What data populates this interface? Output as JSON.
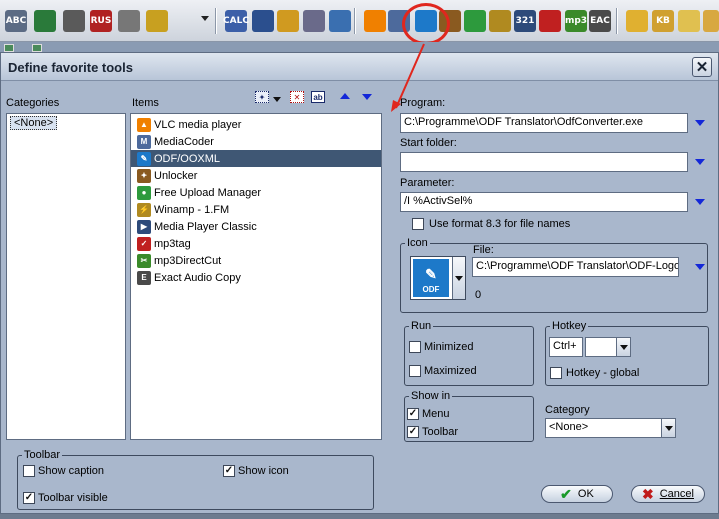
{
  "colors": {
    "accent": "#3f5774",
    "highlight": "#e0271e",
    "arrow_blue": "#1327d8",
    "dialog_bg": "#a9b7cc"
  },
  "toolbar": {
    "icons": [
      {
        "name": "abc-icon",
        "text": "ABC",
        "color": "#5b6b84"
      },
      {
        "name": "globe-icon",
        "text": "",
        "color": "#2a7a3a"
      },
      {
        "name": "document-icon",
        "text": "",
        "color": "#5a5a5a"
      },
      {
        "name": "rus-icon",
        "text": "RUS",
        "color": "#b02222"
      },
      {
        "name": "page-icon",
        "text": "",
        "color": "#777"
      },
      {
        "name": "new-doc-icon",
        "text": "",
        "color": "#c8a020"
      },
      {
        "name": "calc-icon",
        "text": "CALC",
        "color": "#3c5fa8"
      },
      {
        "name": "calendar-icon",
        "text": "",
        "color": "#2b4f8e"
      },
      {
        "name": "tools-icon",
        "text": "",
        "color": "#d09a20"
      },
      {
        "name": "sync-icon",
        "text": "",
        "color": "#6a6a8a"
      },
      {
        "name": "grid-icon",
        "text": "",
        "color": "#3a6fb0"
      },
      {
        "name": "vlc-icon",
        "text": "",
        "color": "#f08000"
      },
      {
        "name": "media-coder-icon",
        "text": "",
        "color": "#4d6a9c"
      },
      {
        "name": "odf-icon",
        "text": "",
        "color": "#1d79c9"
      },
      {
        "name": "unlocker-icon",
        "text": "",
        "color": "#8a5a20"
      },
      {
        "name": "upload-icon",
        "text": "",
        "color": "#2d9a3d"
      },
      {
        "name": "winamp-icon",
        "text": "",
        "color": "#b08a20"
      },
      {
        "name": "mpc-icon",
        "text": "321",
        "color": "#2d4a7a"
      },
      {
        "name": "mp3tag-icon",
        "text": "",
        "color": "#c02020"
      },
      {
        "name": "mp3cut-icon",
        "text": "mp3",
        "color": "#3a8a2a"
      },
      {
        "name": "eac-icon",
        "text": "EAC",
        "color": "#4a4a4a"
      },
      {
        "name": "folder-icon",
        "text": "",
        "color": "#e0b030"
      },
      {
        "name": "kb-icon",
        "text": "KB",
        "color": "#d0a030"
      },
      {
        "name": "note-icon",
        "text": "",
        "color": "#e0c050"
      },
      {
        "name": "folder2-icon",
        "text": "",
        "color": "#d8a840"
      }
    ]
  },
  "dialog": {
    "title": "Define favorite tools",
    "close_label": "✕",
    "categories_label": "Categories",
    "categories": [
      "<None>"
    ],
    "items_label": "Items",
    "items": [
      {
        "label": "VLC media player",
        "icon": "vlc-icon",
        "color": "#f08000",
        "glyph": "▲"
      },
      {
        "label": "MediaCoder",
        "icon": "media-coder-icon",
        "color": "#4d6a9c",
        "glyph": "M"
      },
      {
        "label": "ODF/OOXML",
        "icon": "odf-icon",
        "color": "#1d79c9",
        "glyph": "✎"
      },
      {
        "label": "Unlocker",
        "icon": "unlocker-icon",
        "color": "#8a5a20",
        "glyph": "✦"
      },
      {
        "label": "Free Upload Manager",
        "icon": "upload-icon",
        "color": "#2d9a3d",
        "glyph": "●"
      },
      {
        "label": "Winamp - 1.FM",
        "icon": "winamp-icon",
        "color": "#b08a20",
        "glyph": "⚡"
      },
      {
        "label": "Media Player Classic",
        "icon": "mpc-icon",
        "color": "#2d4a7a",
        "glyph": "▶"
      },
      {
        "label": "mp3tag",
        "icon": "mp3tag-icon",
        "color": "#c02020",
        "glyph": "✓"
      },
      {
        "label": "mp3DirectCut",
        "icon": "mp3cut-icon",
        "color": "#3a8a2a",
        "glyph": "✂"
      },
      {
        "label": "Exact Audio Copy",
        "icon": "eac-icon",
        "color": "#4a4a4a",
        "glyph": "E"
      }
    ],
    "selected_item_index": 2,
    "program_label": "Program:",
    "program_value": "C:\\Programme\\ODF Translator\\OdfConverter.exe",
    "start_folder_label": "Start folder:",
    "start_folder_value": "",
    "parameter_label": "Parameter:",
    "parameter_value": "/I %ActivSel%",
    "format83_label": "Use format 8.3 for file names",
    "icon_group_label": "Icon",
    "file_label": "File:",
    "file_value": "C:\\Programme\\ODF Translator\\ODF-Logo.",
    "icon_index": "0",
    "icon_preview_text": "ODF",
    "run_label": "Run",
    "minimized_label": "Minimized",
    "maximized_label": "Maximized",
    "hotkey_label": "Hotkey",
    "hotkey_modifier": "Ctrl+",
    "hotkey_key": "",
    "hotkey_global_label": "Hotkey - global",
    "show_in_label": "Show in",
    "menu_label": "Menu",
    "toolbar_label": "Toolbar",
    "category_label": "Category",
    "category_value": "<None>",
    "toolbar_group_label": "Toolbar",
    "show_caption_label": "Show caption",
    "show_icon_label": "Show icon",
    "toolbar_visible_label": "Toolbar visible",
    "ok_label": "OK",
    "cancel_label": "Cancel",
    "checks": {
      "format83": false,
      "minimized": false,
      "maximized": false,
      "hotkey_global": false,
      "menu": true,
      "toolbar": true,
      "show_caption": false,
      "show_icon": true,
      "toolbar_visible": true
    }
  }
}
